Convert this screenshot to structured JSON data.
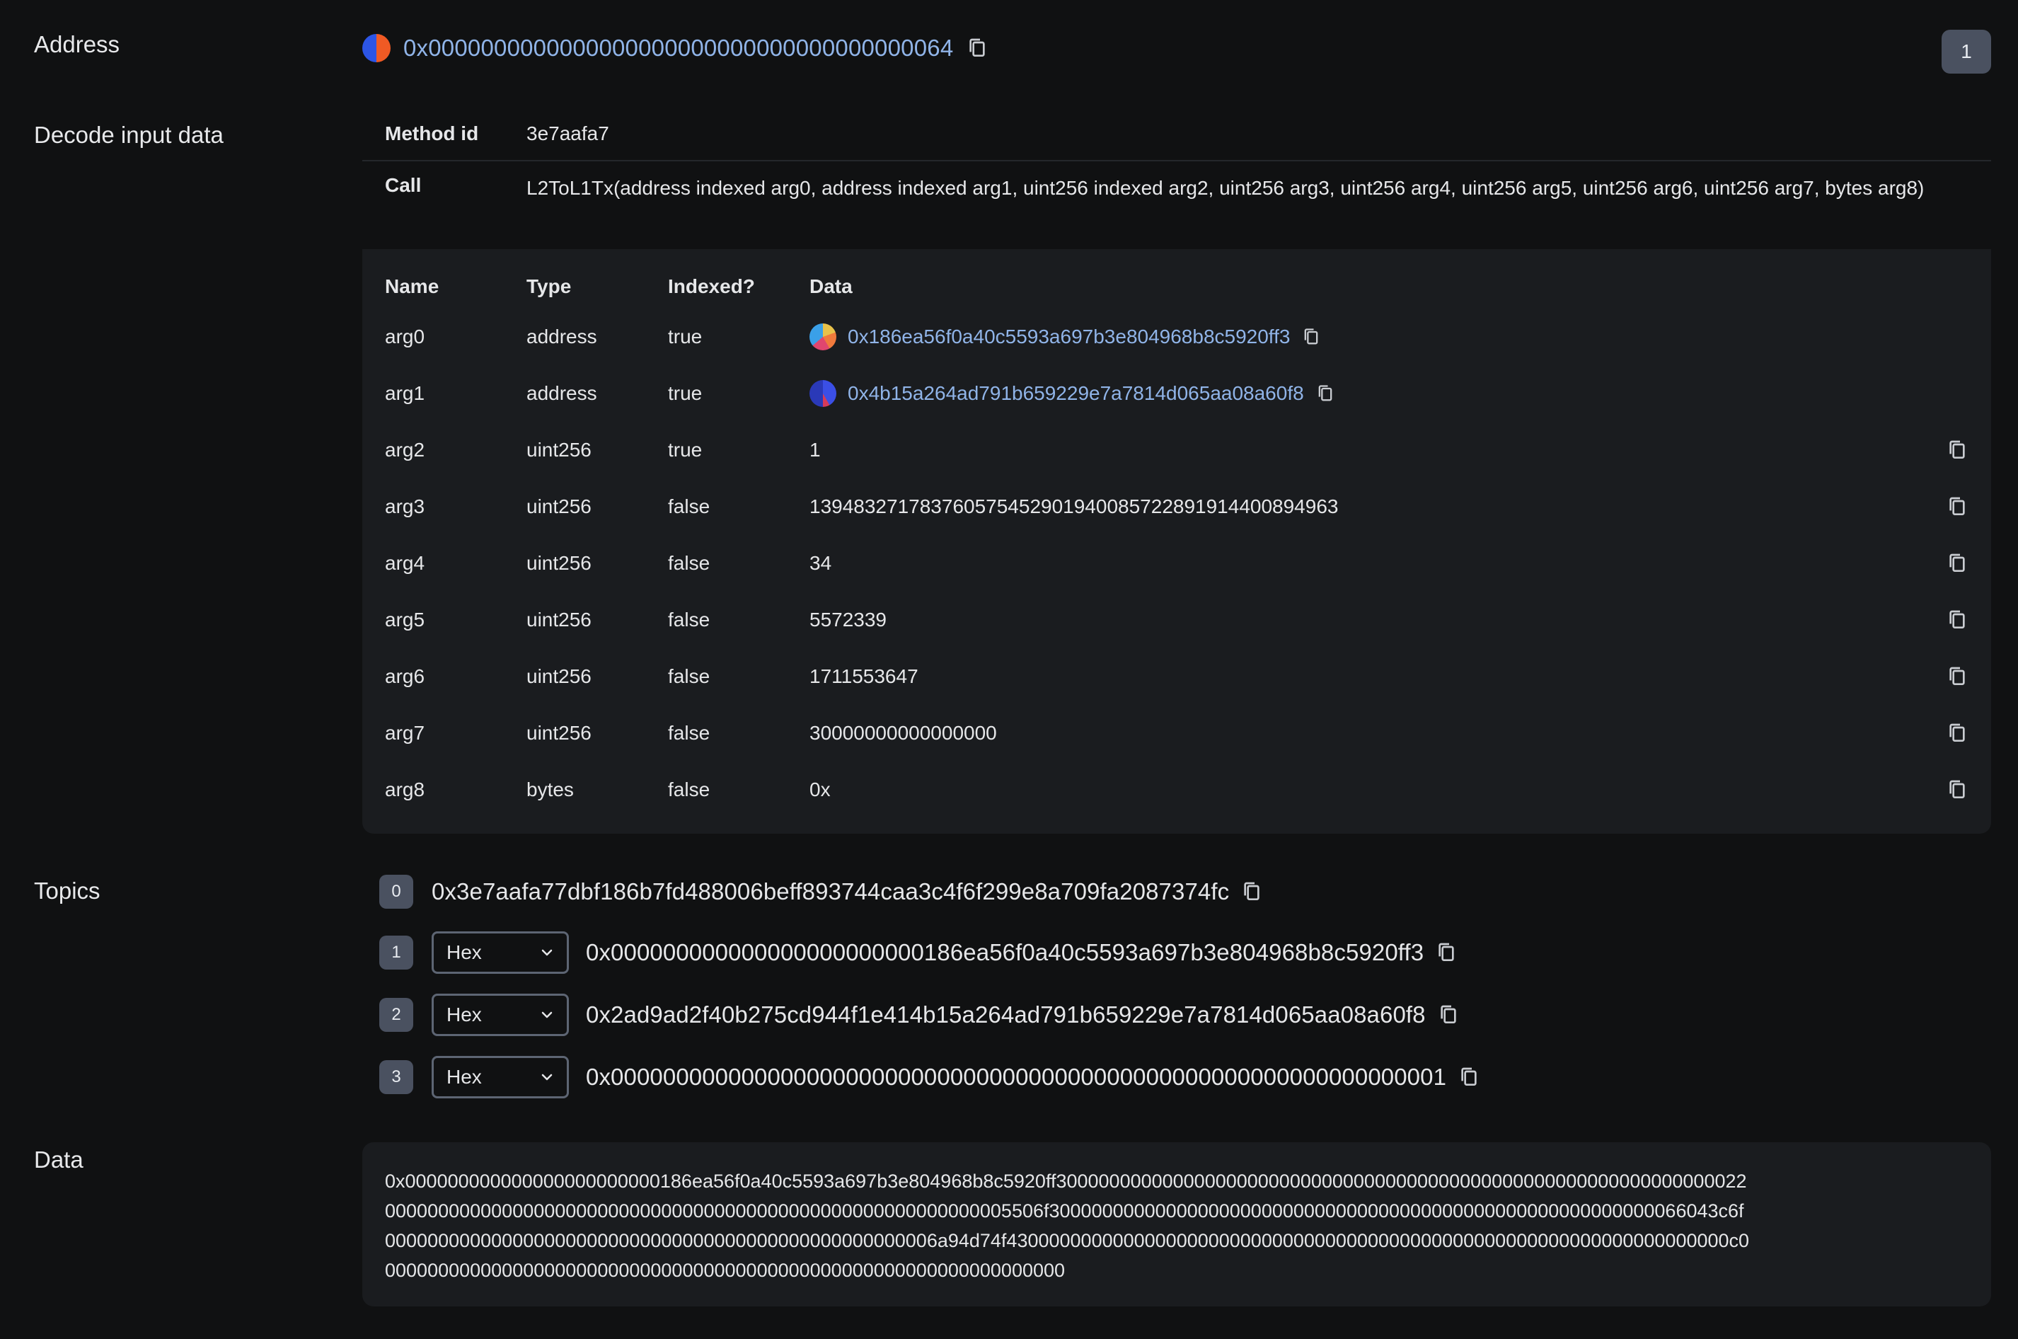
{
  "address": {
    "label": "Address",
    "value": "0x0000000000000000000000000000000000000064",
    "log_index": "1"
  },
  "decode": {
    "label": "Decode input data",
    "method_id_label": "Method id",
    "method_id": "3e7aafa7",
    "call_label": "Call",
    "call": "L2ToL1Tx(address indexed arg0, address indexed arg1, uint256 indexed arg2, uint256 arg3, uint256 arg4, uint256 arg5, uint256 arg6, uint256 arg7, bytes arg8)",
    "headers": {
      "name": "Name",
      "type": "Type",
      "indexed": "Indexed?",
      "data": "Data"
    },
    "args": [
      {
        "name": "arg0",
        "type": "address",
        "indexed": "true",
        "data": "0x186ea56f0a40c5593a697b3e804968b8c5920ff3"
      },
      {
        "name": "arg1",
        "type": "address",
        "indexed": "true",
        "data": "0x4b15a264ad791b659229e7a7814d065aa08a60f8"
      },
      {
        "name": "arg2",
        "type": "uint256",
        "indexed": "true",
        "data": "1"
      },
      {
        "name": "arg3",
        "type": "uint256",
        "indexed": "false",
        "data": "139483271783760575452901940085722891914400894963"
      },
      {
        "name": "arg4",
        "type": "uint256",
        "indexed": "false",
        "data": "34"
      },
      {
        "name": "arg5",
        "type": "uint256",
        "indexed": "false",
        "data": "5572339"
      },
      {
        "name": "arg6",
        "type": "uint256",
        "indexed": "false",
        "data": "1711553647"
      },
      {
        "name": "arg7",
        "type": "uint256",
        "indexed": "false",
        "data": "30000000000000000"
      },
      {
        "name": "arg8",
        "type": "bytes",
        "indexed": "false",
        "data": "0x"
      }
    ]
  },
  "topics": {
    "label": "Topics",
    "items": [
      {
        "index": "0",
        "value": "0x3e7aafa77dbf186b7fd488006beff893744caa3c4f6f299e8a709fa2087374fc"
      },
      {
        "index": "1",
        "format": "Hex",
        "value": "0x000000000000000000000000186ea56f0a40c5593a697b3e804968b8c5920ff3"
      },
      {
        "index": "2",
        "format": "Hex",
        "value": "0x2ad9ad2f40b275cd944f1e414b15a264ad791b659229e7a7814d065aa08a60f8"
      },
      {
        "index": "3",
        "format": "Hex",
        "value": "0x0000000000000000000000000000000000000000000000000000000000000001"
      }
    ]
  },
  "data": {
    "label": "Data",
    "lines": [
      "0x000000000000000000000000186ea56f0a40c5593a697b3e804968b8c5920ff30000000000000000000000000000000000000000000000000000000000000022",
      "00000000000000000000000000000000000000000000000000000000005506f300000000000000000000000000000000000000000000000000000000066043c6f",
      "0000000000000000000000000000000000000000000000000006a94d74f43000000000000000000000000000000000000000000000000000000000000000000c0",
      "0000000000000000000000000000000000000000000000000000000000000000"
    ]
  },
  "colors": {
    "background": "#101112",
    "panel": "#1a1c1f",
    "link": "#90b4e8",
    "badge": "#4a5160"
  }
}
